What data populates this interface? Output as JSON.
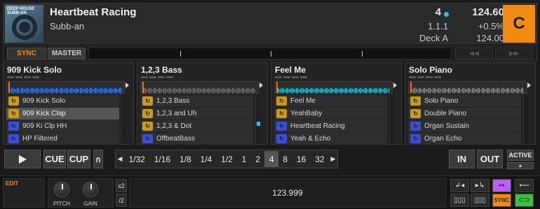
{
  "header": {
    "art_label": "DEEP HOUSE SUBB-AN",
    "title": "Heartbeat Racing",
    "artist": "Subb-an",
    "beat_counter": "4",
    "bpm": "124.60",
    "position": "1.1.1",
    "tempo_offset": "+0.5%",
    "deck_name": "Deck A",
    "base_bpm": "124.00",
    "key": "C"
  },
  "sync": {
    "sync_label": "SYNC",
    "master_label": "MASTER"
  },
  "slots": [
    {
      "name": "909 Kick Solo",
      "wave_color": "#4f8cff",
      "items": [
        {
          "label": "909 Kick Solo",
          "color": "#c79b22"
        },
        {
          "label": "909 Kick Clap",
          "color": "#c79b22",
          "selected": true
        },
        {
          "label": "909 Ki Clp HH",
          "color": "#3d4ed6"
        },
        {
          "label": "HP Filtered",
          "color": "#3d4ed6"
        }
      ]
    },
    {
      "name": "1,2,3 Bass",
      "wave_color": "#4f8cff",
      "items": [
        {
          "label": "1,2,3 Bass",
          "color": "#c79b22"
        },
        {
          "label": "1,2,3 and Uh",
          "color": "#c79b22"
        },
        {
          "label": "1,2,3 & Dot",
          "color": "#c79b22"
        },
        {
          "label": "OffbeatBass",
          "color": "#3d4ed6"
        }
      ]
    },
    {
      "name": "Feel Me",
      "wave_color": "#3ed6e6",
      "items": [
        {
          "label": "Feel Me",
          "color": "#c79b22"
        },
        {
          "label": "YeahBaby",
          "color": "#c79b22"
        },
        {
          "label": "Heartbeat Racing",
          "color": "#3d4ed6"
        },
        {
          "label": "Yeah & Echo",
          "color": "#3d4ed6"
        }
      ]
    },
    {
      "name": "Solo Piano",
      "wave_color": "#3ed6e6",
      "items": [
        {
          "label": "Solo Piano",
          "color": "#c79b22"
        },
        {
          "label": "Double Piano",
          "color": "#c79b22"
        },
        {
          "label": "Organ Sustain",
          "color": "#3d4ed6"
        },
        {
          "label": "Organ Echo",
          "color": "#3d4ed6"
        }
      ]
    }
  ],
  "transport": {
    "cue": "CUE",
    "cup": "CUP",
    "flux": "ก",
    "loops": [
      "1/32",
      "1/16",
      "1/8",
      "1/4",
      "1/2",
      "1",
      "2",
      "4",
      "8",
      "16",
      "32"
    ],
    "active_loop": "4",
    "in": "IN",
    "out": "OUT",
    "active": "ACTIVE",
    "active_sub": "▲"
  },
  "bottom": {
    "edit": "EDIT",
    "pitch": "PITCH",
    "gain": "GAIN",
    "x2": "x2",
    "half": "/2",
    "tempo_value": "123.999",
    "sync": "SYNC"
  },
  "colors": {
    "accent": "#f08a12",
    "blue": "#36b8e8",
    "purple": "#c05cff",
    "green": "#3fbf3f"
  }
}
